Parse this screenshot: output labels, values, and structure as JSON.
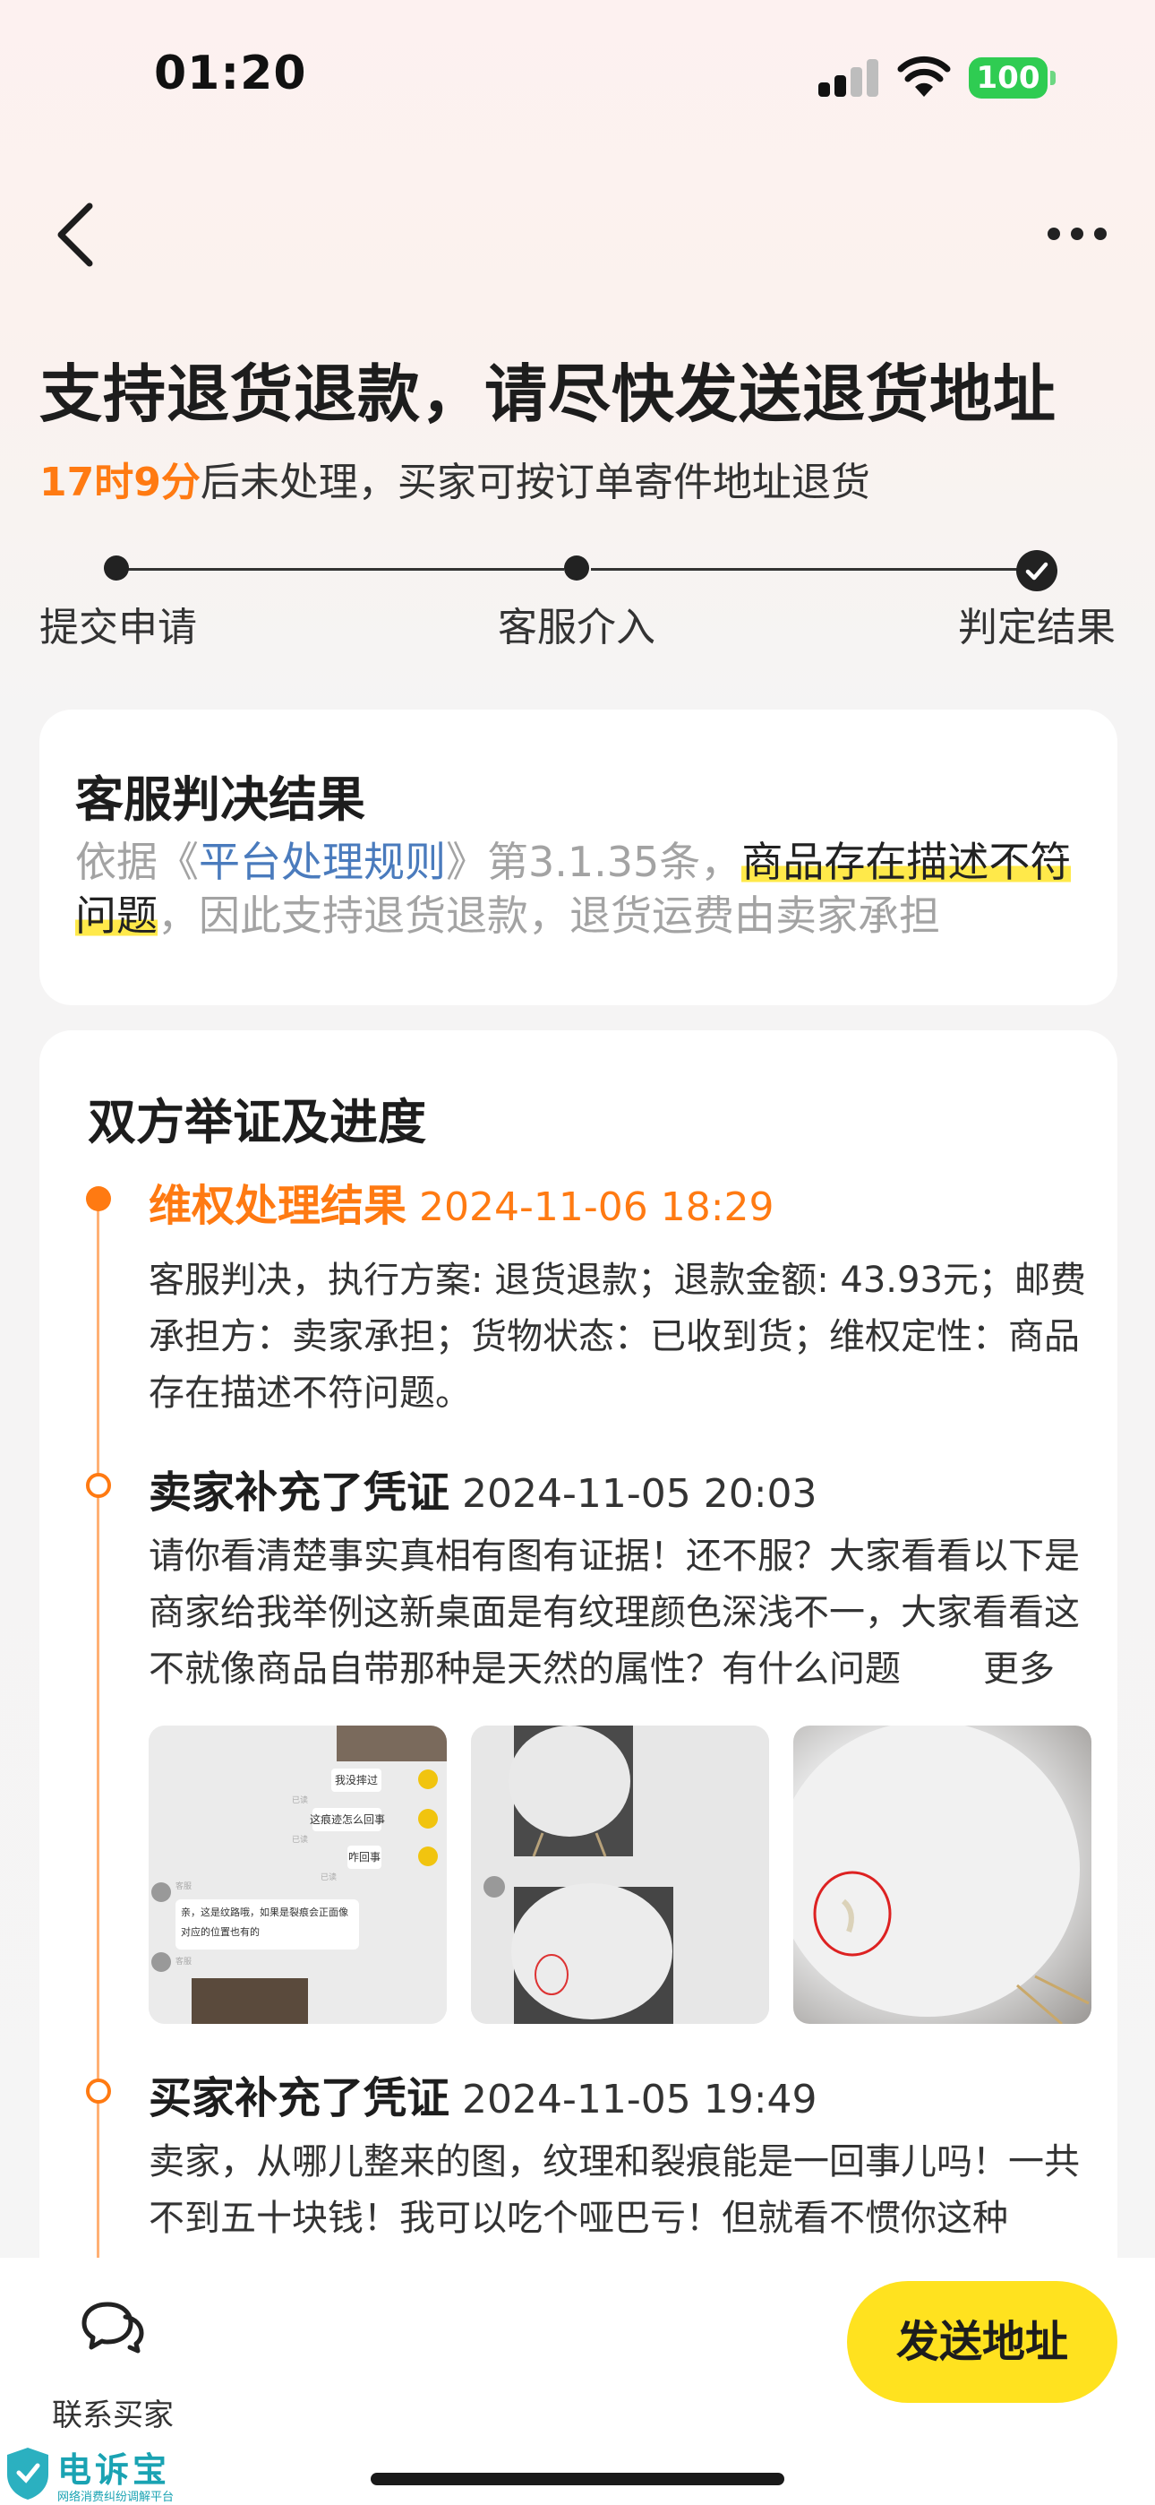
{
  "status_bar": {
    "time": "01:20",
    "battery": "100"
  },
  "header": {
    "title": "支持退货退款，请尽快发送退货地址",
    "deadline": "17时9分",
    "deadline_suffix": "后未处理，买家可按订单寄件地址退货"
  },
  "steps": [
    "提交申请",
    "客服介入",
    "判定结果"
  ],
  "verdict_card": {
    "title": "客服判决结果",
    "prefix": "依据《",
    "rule_link": "平台处理规则",
    "rule_suffix": "》第3.1.35条，",
    "highlight": "商品存在描述不符问题",
    "suffix": "，因此支持退货退款，退货运费由卖家承担"
  },
  "evidence_card": {
    "title": "双方举证及进度",
    "events": [
      {
        "title": "维权处理结果",
        "time": "2024-11-06 18:29",
        "body": "客服判决，执行方案: 退货退款；退款金额: 43.93元；邮费承担方：卖家承担；货物状态：已收到货；维权定性：商品存在描述不符问题。"
      },
      {
        "title": "卖家补充了凭证",
        "time": "2024-11-05 20:03",
        "body": "请你看清楚事实真相有图有证据！还不服？大家看看以下是商家给我举例这新桌面是有纹理颜色深浅不一，大家看看这不就像商品自带那种是天然的属性？有什么问题",
        "more": "更多"
      },
      {
        "title": "买家补充了凭证",
        "time": "2024-11-05 19:49",
        "body": "卖家，从哪儿整来的图，纹理和裂痕能是一回事儿吗！一共不到五十块钱！我可以吃个哑巴亏！但就看不惯你这种"
      }
    ],
    "chat_screenshot": {
      "messages": [
        "我没摔过",
        "这痕迹怎么回事",
        "咋回事"
      ],
      "reply": "亲，这是纹路哦，如果是裂痕会正面像对应的位置也有的",
      "meta": [
        "已读",
        "已读",
        "已读",
        "客服",
        "客服"
      ]
    }
  },
  "bottom_bar": {
    "contact_label": "联系买家",
    "send_button": "发送地址"
  },
  "watermark": {
    "name": "电诉宝",
    "subtitle": "网络消费纠纷调解平台"
  },
  "colors": {
    "accent": "#ff7a12",
    "button": "#ffe21f",
    "link": "#4a7bbd",
    "highlight": "#ffe94a"
  }
}
